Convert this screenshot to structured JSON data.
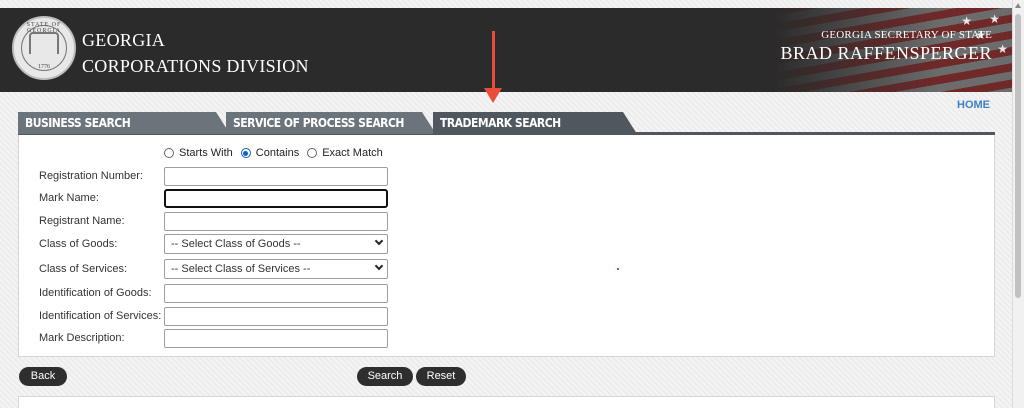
{
  "header": {
    "org_line1": "GEORGIA",
    "org_line2": "CORPORATIONS DIVISION",
    "sos_title": "GEORGIA SECRETARY OF STATE",
    "sos_name": "BRAD RAFFENSPERGER",
    "seal_text": "STATE OF GEORGIA",
    "seal_year": "1776"
  },
  "nav": {
    "home": "HOME"
  },
  "tabs": [
    {
      "label": "BUSINESS SEARCH",
      "active": false
    },
    {
      "label": "SERVICE OF PROCESS SEARCH",
      "active": false
    },
    {
      "label": "TRADEMARK SEARCH",
      "active": true
    }
  ],
  "search_mode": {
    "options": [
      "Starts With",
      "Contains",
      "Exact Match"
    ],
    "selected": "Contains"
  },
  "fields": {
    "registration_number": {
      "label": "Registration Number:",
      "value": ""
    },
    "mark_name": {
      "label": "Mark Name:",
      "value": ""
    },
    "registrant_name": {
      "label": "Registrant Name:",
      "value": ""
    },
    "class_of_goods": {
      "label": "Class of Goods:",
      "selected": "-- Select Class of Goods --"
    },
    "class_of_services": {
      "label": "Class of Services:",
      "selected": "-- Select Class of Services --"
    },
    "identification_of_goods": {
      "label": "Identification of Goods:",
      "value": ""
    },
    "identification_of_services": {
      "label": "Identification of Services:",
      "value": ""
    },
    "mark_description": {
      "label": "Mark Description:",
      "value": ""
    }
  },
  "buttons": {
    "back": "Back",
    "search": "Search",
    "reset": "Reset"
  },
  "colors": {
    "header_bg": "#2b2b2b",
    "tab_bg": "#6b737b",
    "tab_active_bg": "#51575e",
    "accent_arrow": "#e84d3a",
    "link": "#3d82c2"
  }
}
